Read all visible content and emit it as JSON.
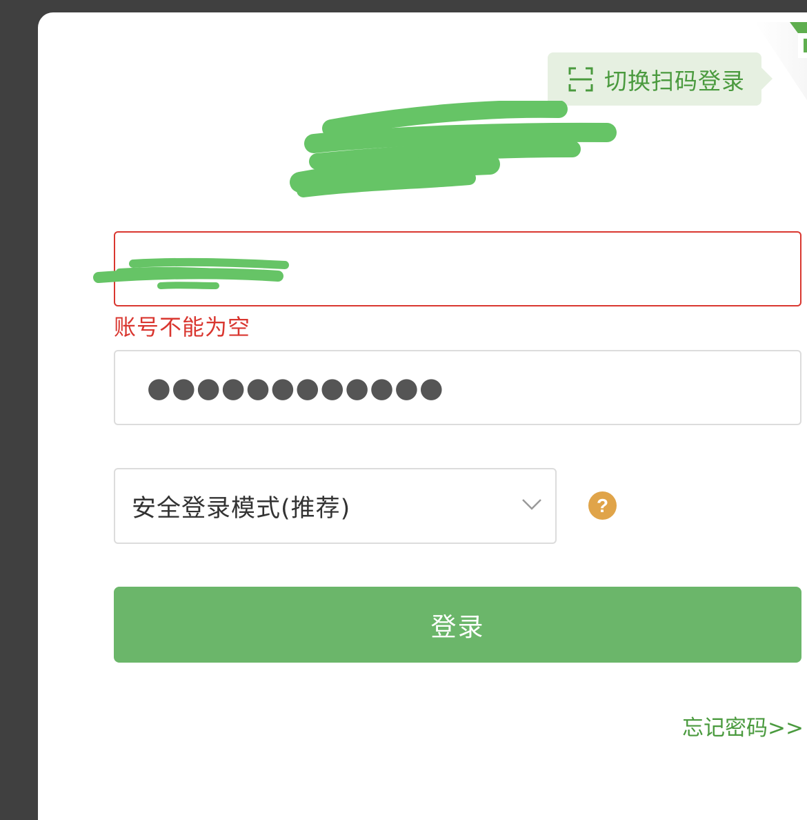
{
  "qr_toggle": {
    "tooltip": "切换扫码登录",
    "icon": "scan-icon",
    "corner_icon": "qr-corner-icon"
  },
  "title": {
    "redacted": true
  },
  "account": {
    "value_redacted": true,
    "error": "账号不能为空"
  },
  "password": {
    "masked_value": "●●●●●●●●●●●●"
  },
  "login_mode": {
    "selected": "安全登录模式(推荐)",
    "help_icon": "?"
  },
  "login_button": {
    "label": "登录"
  },
  "forgot_password": {
    "label": "忘记密码>>"
  },
  "colors": {
    "accent": "#6bb66a",
    "error": "#d9362f",
    "link": "#4a9a3e",
    "help": "#e0a449",
    "backdrop": "#404040"
  }
}
